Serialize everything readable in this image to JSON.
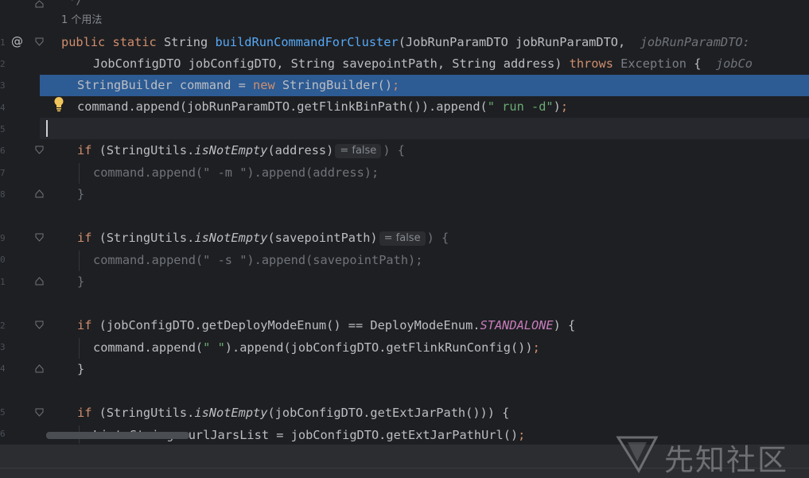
{
  "editor": {
    "top_partial": " */",
    "usage_hint": "1 个用法",
    "line_markers": [
      "@"
    ],
    "code": {
      "sig1": {
        "mod1": "public",
        "mod2": "static",
        "ret": "String",
        "method": "buildRunCommandForCluster",
        "params": "(JobRunParamDTO jobRunParamDTO,",
        "hint": "jobRunParamDTO:"
      },
      "sig2": {
        "text": "JobConfigDTO jobConfigDTO, String savepointPath, String address)",
        "throws": "throws",
        "exception": "Exception",
        "brace": "{",
        "hint": "jobCo"
      },
      "l3": {
        "a": "StringBuilder command = ",
        "kw": "new",
        "b": " StringBuilder()",
        "semi": ";"
      },
      "l4": {
        "a": "command.append(jobRunParamDTO.getFlinkBinPath()).append(",
        "str": "\" run -d\"",
        "b": ")",
        "semi": ";"
      },
      "if1": {
        "kw": "if",
        "a": " (StringUtils.",
        "m": "isNotEmpty",
        "b": "(address)",
        "inlay": "= false",
        "c": ") {"
      },
      "if1_body": {
        "a": "command.append(",
        "str": "\" -m \"",
        "b": ").append(address);"
      },
      "close1": "}",
      "if2": {
        "kw": "if",
        "a": " (StringUtils.",
        "m": "isNotEmpty",
        "b": "(savepointPath)",
        "inlay": "= false",
        "c": ") {"
      },
      "if2_body": {
        "a": "command.append(",
        "str": "\" -s \"",
        "b": ").append(savepointPath);"
      },
      "close2": "}",
      "if3": {
        "kw": "if",
        "a": " (jobConfigDTO.getDeployModeEnum() == DeployModeEnum.",
        "k": "STANDALONE",
        "b": ") {"
      },
      "if3_body": {
        "a": "command.append(",
        "str": "\" \"",
        "b": ").append(jobConfigDTO.getFlinkRunConfig())",
        "semi": ";"
      },
      "close3": "}",
      "if4": {
        "kw": "if",
        "a": " (StringUtils.",
        "m": "isNotEmpty",
        "b": "(jobConfigDTO.getExtJarPath())) {"
      },
      "if4_body": {
        "a": "List<String> urlJarsList = jobConfigDTO.getExtJarPathUrl()",
        "semi": ";"
      }
    }
  },
  "watermark": {
    "text": "先知社区",
    "icon": "xianzhi-logo-icon"
  },
  "colors": {
    "background": "#1e1f22",
    "selection": "#2d5b93",
    "keyword": "#cf8e6d",
    "method": "#56a8f5",
    "string": "#6aab73",
    "constant": "#c77dbb"
  }
}
